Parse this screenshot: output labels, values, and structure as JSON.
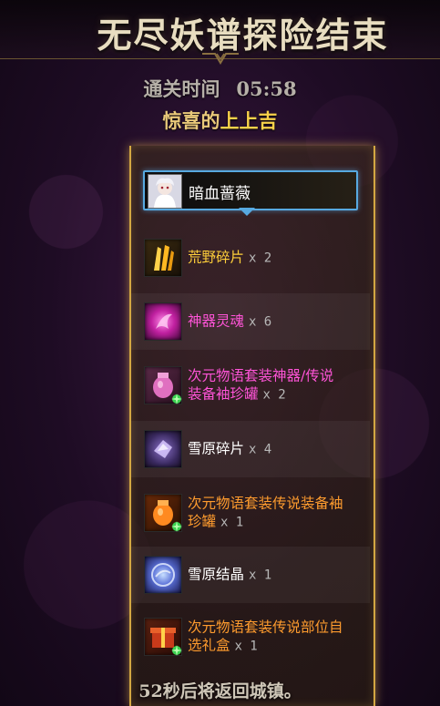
{
  "title": "无尽妖谱探险结束",
  "clear_time": {
    "label": "通关时间",
    "value": "05:58"
  },
  "luck": {
    "prefix": "惊喜的",
    "highlight": "上上吉"
  },
  "character": {
    "name": "暗血蔷薇"
  },
  "rewards": [
    {
      "name": "荒野碎片",
      "qty": "x 2",
      "color": "#ffcf3a",
      "icon": "golden-shard-icon"
    },
    {
      "name": "神器灵魂",
      "qty": "x 6",
      "color": "#ff54d8",
      "icon": "artifact-soul-icon"
    },
    {
      "name_line1": "次元物语套装神器/传说",
      "name_line2": "装备袖珍罐",
      "qty": "x 2",
      "color": "#ff54d8",
      "icon": "artifact-jar-icon"
    },
    {
      "name": "雪原碎片",
      "qty": "x 4",
      "color": "#ffffff",
      "icon": "snow-shard-icon"
    },
    {
      "name_line1": "次元物语套装传说装备袖",
      "name_line2": "珍罐",
      "qty": "x 1",
      "color": "#ff9c2e",
      "icon": "legendary-jar-icon"
    },
    {
      "name": "雪原结晶",
      "qty": "x 1",
      "color": "#ffffff",
      "icon": "snow-crystal-icon"
    },
    {
      "name_line1": "次元物语套装传说部位自",
      "name_line2": "选礼盒",
      "qty": "x 1",
      "color": "#ff9c2e",
      "icon": "gift-box-icon"
    }
  ],
  "footer": "52秒后将返回城镇。"
}
